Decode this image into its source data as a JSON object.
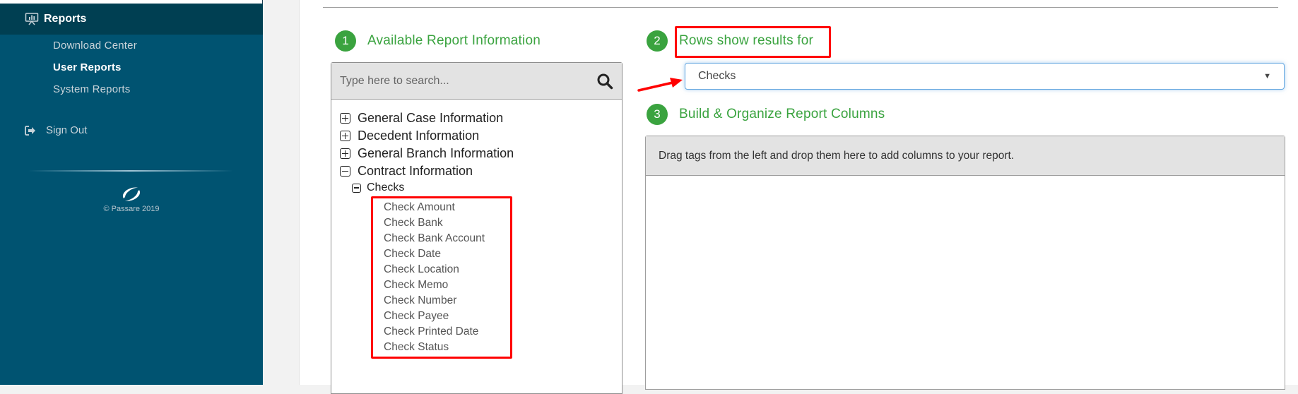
{
  "sidebar": {
    "section_label": "Reports",
    "section_icon": "presentation-chart-icon",
    "items": [
      {
        "label": "Download Center",
        "active": false
      },
      {
        "label": "User Reports",
        "active": true
      },
      {
        "label": "System Reports",
        "active": false
      }
    ],
    "sign_out_label": "Sign Out",
    "sign_out_icon": "sign-out-icon",
    "copyright": "© Passare 2019"
  },
  "steps": [
    {
      "number": "1",
      "title": "Available Report Information"
    },
    {
      "number": "2",
      "title": "Rows show results for"
    },
    {
      "number": "3",
      "title": "Build & Organize Report Columns"
    }
  ],
  "search": {
    "placeholder": "Type here to search...",
    "value": ""
  },
  "tree": {
    "categories": [
      {
        "label": "General Case Information",
        "state": "collapsed"
      },
      {
        "label": "Decedent Information",
        "state": "collapsed"
      },
      {
        "label": "General Branch Information",
        "state": "collapsed"
      },
      {
        "label": "Contract Information",
        "state": "expanded"
      }
    ],
    "subcategory": {
      "label": "Checks",
      "state": "expanded"
    },
    "fields": [
      "Check Amount",
      "Check Bank",
      "Check Bank Account",
      "Check Date",
      "Check Location",
      "Check Memo",
      "Check Number",
      "Check Payee",
      "Check Printed Date",
      "Check Status"
    ]
  },
  "rows_select": {
    "value": "Checks"
  },
  "columns": {
    "drop_hint": "Drag tags from the left and drop them here to add columns to your report."
  },
  "colors": {
    "sidebar_bg": "#005371",
    "sidebar_header_bg": "#003f52",
    "step_green": "#3aa33f",
    "annotation_red": "#ff0000",
    "focus_blue": "#66a8e0"
  }
}
